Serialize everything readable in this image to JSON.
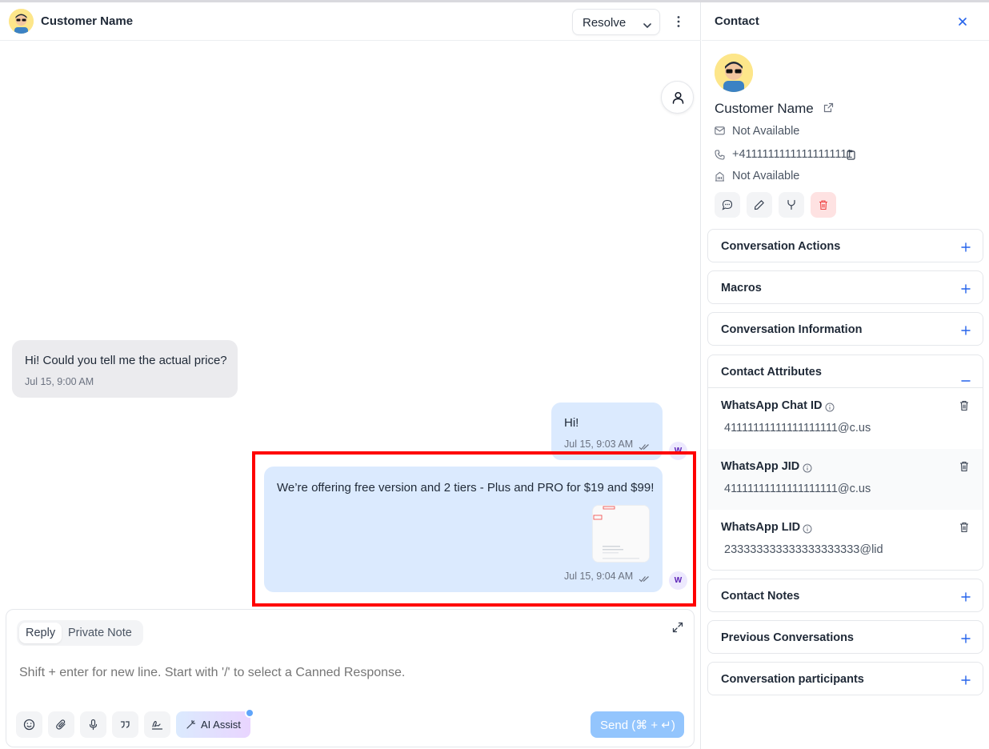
{
  "header": {
    "customer_name": "Customer Name",
    "resolve_label": "Resolve"
  },
  "messages": [
    {
      "direction": "incoming",
      "text": "Hi! Could you tell me the actual price?",
      "time": "Jul 15, 9:00 AM"
    },
    {
      "direction": "outgoing",
      "text": "Hi!",
      "time": "Jul 15, 9:03 AM",
      "agent_initial": "W"
    },
    {
      "direction": "outgoing",
      "text": "We’re offering free version and 2 tiers - Plus and PRO for $19 and $99!",
      "time": "Jul 15, 9:04 AM",
      "agent_initial": "W",
      "has_attachment": true
    }
  ],
  "composer": {
    "tab_reply": "Reply",
    "tab_private_note": "Private Note",
    "placeholder": "Shift + enter for new line. Start with '/' to select a Canned Response.",
    "ai_assist_label": "AI Assist",
    "send_label": "Send (⌘ + ↵)",
    "tools": [
      "emoji-icon",
      "paperclip-icon",
      "microphone-icon",
      "quote-icon",
      "signature-icon"
    ]
  },
  "contact_panel": {
    "title": "Contact",
    "name": "Customer Name",
    "email": "Not Available",
    "phone": "+41111111111111111111",
    "company": "Not Available",
    "actions": [
      "message-icon",
      "edit-icon",
      "merge-icon",
      "trash-icon"
    ],
    "sections": {
      "conversation_actions": "Conversation Actions",
      "macros": "Macros",
      "conversation_information": "Conversation Information",
      "contact_attributes": "Contact Attributes",
      "contact_notes": "Contact Notes",
      "previous_conversations": "Previous Conversations",
      "conversation_participants": "Conversation participants"
    },
    "attributes": [
      {
        "name": "WhatsApp Chat ID",
        "value": "41111111111111111111@c.us"
      },
      {
        "name": "WhatsApp JID",
        "value": "41111111111111111111@c.us"
      },
      {
        "name": "WhatsApp LID",
        "value": "233333333333333333333@lid"
      }
    ]
  },
  "colors": {
    "outgoing_bubble": "#dbeafe",
    "incoming_bubble": "#ebebee",
    "accent": "#2563eb",
    "highlight": "#ff0000",
    "send_button": "#93c5fd"
  }
}
